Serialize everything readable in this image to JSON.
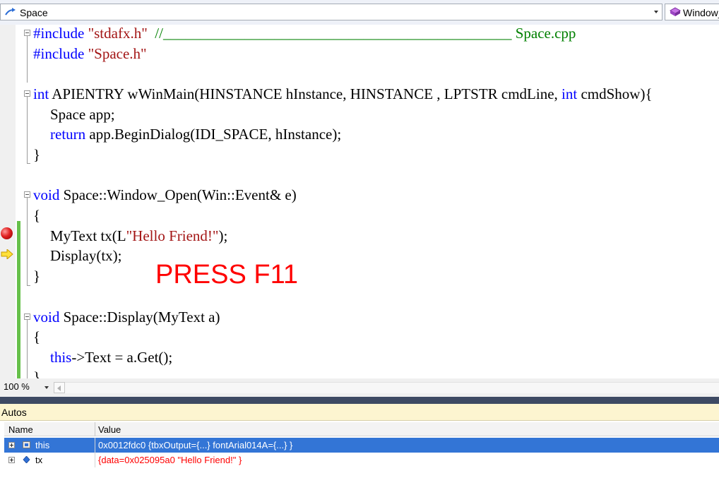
{
  "navigation": {
    "type_combo": "Space",
    "member_combo": "Window_"
  },
  "code_lines": [
    [
      {
        "t": "#include ",
        "c": "kw"
      },
      {
        "t": "\"stdafx.h\"",
        "c": "str"
      },
      {
        "t": "  ",
        "c": ""
      },
      {
        "t": "//_______________________________________________ Space.cpp",
        "c": "cmt"
      }
    ],
    [
      {
        "t": "#include ",
        "c": "kw"
      },
      {
        "t": "\"Space.h\"",
        "c": "str"
      }
    ],
    [],
    [
      {
        "t": "int",
        "c": "kw"
      },
      {
        "t": " APIENTRY wWinMain(HINSTANCE hInstance, HINSTANCE , LPTSTR cmdLine, ",
        "c": ""
      },
      {
        "t": "int",
        "c": "kw"
      },
      {
        "t": " cmdShow){",
        "c": ""
      }
    ],
    [
      {
        "t": "Space app;",
        "c": ""
      }
    ],
    [
      {
        "t": "return",
        "c": "kw"
      },
      {
        "t": " app.BeginDialog(IDI_SPACE, hInstance);",
        "c": ""
      }
    ],
    [
      {
        "t": "}",
        "c": ""
      }
    ],
    [],
    [
      {
        "t": "void",
        "c": "kw"
      },
      {
        "t": " Space::Window_Open(Win::Event& e)",
        "c": ""
      }
    ],
    [
      {
        "t": "{",
        "c": ""
      }
    ],
    [
      {
        "t": "MyText tx(L",
        "c": ""
      },
      {
        "t": "\"Hello Friend!\"",
        "c": "str"
      },
      {
        "t": ");",
        "c": ""
      }
    ],
    [
      {
        "t": "Display(tx);",
        "c": ""
      }
    ],
    [
      {
        "t": "}",
        "c": ""
      }
    ],
    [],
    [
      {
        "t": "void",
        "c": "kw"
      },
      {
        "t": " Space::Display(MyText a)",
        "c": ""
      }
    ],
    [
      {
        "t": "{",
        "c": ""
      }
    ],
    [
      {
        "t": "this",
        "c": "kw"
      },
      {
        "t": "->Text = a.Get();",
        "c": ""
      }
    ],
    [
      {
        "t": "}",
        "c": ""
      }
    ]
  ],
  "annotation": "PRESS F11",
  "zoom": "100 %",
  "autos": {
    "title": "Autos",
    "columns": {
      "name": "Name",
      "value": "Value"
    },
    "rows": [
      {
        "name": "this",
        "value": "0x0012fdc0 {tbxOutput={...} fontArial014A={...} }",
        "selected": true,
        "changed": false,
        "icon": "class-member-icon"
      },
      {
        "name": "tx",
        "value": "{data=0x025095a0 \"Hello Friend!\" }",
        "selected": false,
        "changed": true,
        "icon": "local-variable-icon"
      }
    ]
  }
}
